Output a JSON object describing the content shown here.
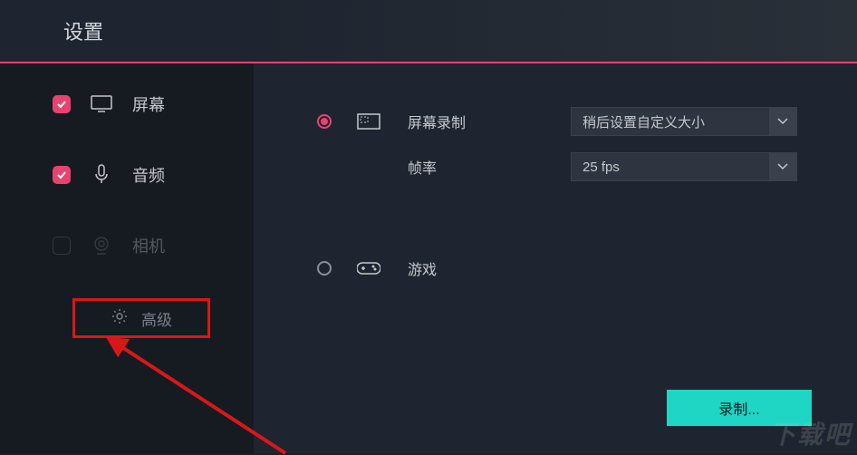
{
  "header": {
    "title": "设置"
  },
  "sidebar": {
    "items": [
      {
        "label": "屏幕",
        "checked": true,
        "icon": "monitor"
      },
      {
        "label": "音频",
        "checked": true,
        "icon": "mic"
      },
      {
        "label": "相机",
        "checked": false,
        "icon": "webcam"
      }
    ],
    "advanced_label": "高级"
  },
  "main": {
    "screen_recording": {
      "label": "屏幕录制",
      "selected": true,
      "size_select": "稍后设置自定义大小",
      "fps_label": "帧率",
      "fps_value": "25 fps"
    },
    "game": {
      "label": "游戏",
      "selected": false
    },
    "record_button": "录制..."
  },
  "annotation": {
    "highlight_color": "#d81818",
    "arrow_color": "#d81818"
  },
  "watermark": "下载吧"
}
